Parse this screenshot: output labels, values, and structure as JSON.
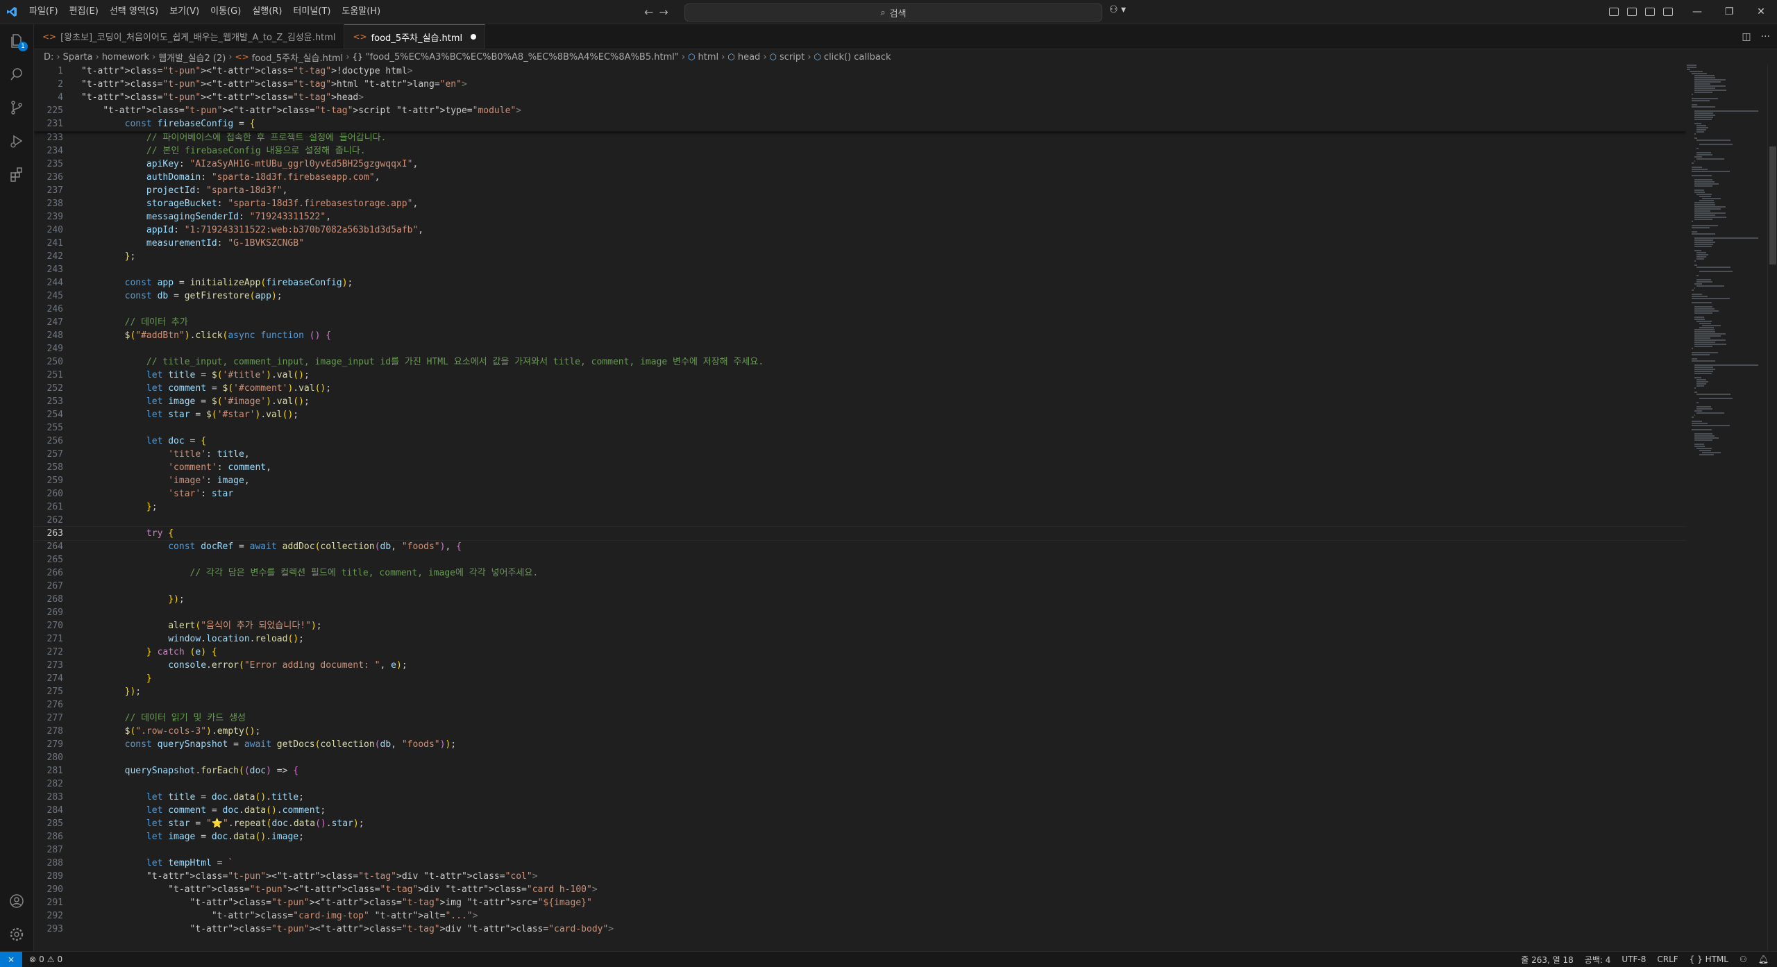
{
  "menus": [
    "파일(F)",
    "편집(E)",
    "선택 영역(S)",
    "보기(V)",
    "이동(G)",
    "실행(R)",
    "터미널(T)",
    "도움말(H)"
  ],
  "search_placeholder": "검색",
  "tabs": [
    {
      "label": "[왕초보]_코딩이_처음이어도_쉽게_배우는_웹개발_A_to_Z_김성윤.html",
      "active": false
    },
    {
      "label": "food_5주차_실습.html",
      "active": true,
      "dirty": true
    }
  ],
  "breadcrumbs": [
    "D:",
    "Sparta",
    "homework",
    "웹개발_실습2 (2)",
    "food_5주차_실습.html",
    "\"food_5%EC%A3%BC%EC%B0%A8_%EC%8B%A4%EC%8A%B5.html\"",
    "html",
    "head",
    "script",
    "click() callback"
  ],
  "sticky_lines": [
    {
      "n": "1",
      "code": "<!doctype html>"
    },
    {
      "n": "2",
      "code": "<html lang=\"en\">"
    },
    {
      "n": "4",
      "code": "<head>"
    },
    {
      "n": "225",
      "code": "    <script type=\"module\">"
    },
    {
      "n": "231",
      "code": "        const firebaseConfig = {"
    }
  ],
  "lines": [
    {
      "n": "233",
      "code": "            // 파이어베이스에 접속한 후 프로젝트 설정에 들어갑니다."
    },
    {
      "n": "234",
      "code": "            // 본인 firebaseConfig 내용으로 설정해 줍니다."
    },
    {
      "n": "235",
      "code": "            apiKey: \"AIzaSyAH1G-mtUBu_ggrl0yvEd5BH25gzgwqqxI\","
    },
    {
      "n": "236",
      "code": "            authDomain: \"sparta-18d3f.firebaseapp.com\","
    },
    {
      "n": "237",
      "code": "            projectId: \"sparta-18d3f\","
    },
    {
      "n": "238",
      "code": "            storageBucket: \"sparta-18d3f.firebasestorage.app\","
    },
    {
      "n": "239",
      "code": "            messagingSenderId: \"719243311522\","
    },
    {
      "n": "240",
      "code": "            appId: \"1:719243311522:web:b370b7082a563b1d3d5afb\","
    },
    {
      "n": "241",
      "code": "            measurementId: \"G-1BVKSZCNGB\""
    },
    {
      "n": "242",
      "code": "        };"
    },
    {
      "n": "243",
      "code": ""
    },
    {
      "n": "244",
      "code": "        const app = initializeApp(firebaseConfig);"
    },
    {
      "n": "245",
      "code": "        const db = getFirestore(app);"
    },
    {
      "n": "246",
      "code": ""
    },
    {
      "n": "247",
      "code": "        // 데이터 추가"
    },
    {
      "n": "248",
      "code": "        $(\"#addBtn\").click(async function () {"
    },
    {
      "n": "249",
      "code": ""
    },
    {
      "n": "250",
      "code": "            // title_input, comment_input, image_input id를 가진 HTML 요소에서 값을 가져와서 title, comment, image 변수에 저장해 주세요."
    },
    {
      "n": "251",
      "code": "            let title = $('#title').val();"
    },
    {
      "n": "252",
      "code": "            let comment = $('#comment').val();"
    },
    {
      "n": "253",
      "code": "            let image = $('#image').val();"
    },
    {
      "n": "254",
      "code": "            let star = $('#star').val();"
    },
    {
      "n": "255",
      "code": ""
    },
    {
      "n": "256",
      "code": "            let doc = {"
    },
    {
      "n": "257",
      "code": "                'title': title,"
    },
    {
      "n": "258",
      "code": "                'comment': comment,"
    },
    {
      "n": "259",
      "code": "                'image': image,"
    },
    {
      "n": "260",
      "code": "                'star': star"
    },
    {
      "n": "261",
      "code": "            };"
    },
    {
      "n": "262",
      "code": ""
    },
    {
      "n": "263",
      "code": "            try {",
      "current": true
    },
    {
      "n": "264",
      "code": "                const docRef = await addDoc(collection(db, \"foods\"), {"
    },
    {
      "n": "265",
      "code": ""
    },
    {
      "n": "266",
      "code": "                    // 각각 담은 변수를 컬렉션 필드에 title, comment, image에 각각 넣어주세요."
    },
    {
      "n": "267",
      "code": ""
    },
    {
      "n": "268",
      "code": "                });"
    },
    {
      "n": "269",
      "code": ""
    },
    {
      "n": "270",
      "code": "                alert(\"음식이 추가 되었습니다!\");"
    },
    {
      "n": "271",
      "code": "                window.location.reload();"
    },
    {
      "n": "272",
      "code": "            } catch (e) {"
    },
    {
      "n": "273",
      "code": "                console.error(\"Error adding document: \", e);"
    },
    {
      "n": "274",
      "code": "            }"
    },
    {
      "n": "275",
      "code": "        });"
    },
    {
      "n": "276",
      "code": ""
    },
    {
      "n": "277",
      "code": "        // 데이터 읽기 및 카드 생성"
    },
    {
      "n": "278",
      "code": "        $(\".row-cols-3\").empty();"
    },
    {
      "n": "279",
      "code": "        const querySnapshot = await getDocs(collection(db, \"foods\"));"
    },
    {
      "n": "280",
      "code": ""
    },
    {
      "n": "281",
      "code": "        querySnapshot.forEach((doc) => {"
    },
    {
      "n": "282",
      "code": ""
    },
    {
      "n": "283",
      "code": "            let title = doc.data().title;"
    },
    {
      "n": "284",
      "code": "            let comment = doc.data().comment;"
    },
    {
      "n": "285",
      "code": "            let star = \"⭐\".repeat(doc.data().star);"
    },
    {
      "n": "286",
      "code": "            let image = doc.data().image;"
    },
    {
      "n": "287",
      "code": ""
    },
    {
      "n": "288",
      "code": "            let tempHtml = `"
    },
    {
      "n": "289",
      "code": "            <div class=\"col\">"
    },
    {
      "n": "290",
      "code": "                <div class=\"card h-100\">"
    },
    {
      "n": "291",
      "code": "                    <img src=\"${image}\""
    },
    {
      "n": "292",
      "code": "                        class=\"card-img-top\" alt=\"...\">"
    },
    {
      "n": "293",
      "code": "                    <div class=\"card-body\">"
    }
  ],
  "status": {
    "errors": "0",
    "warnings": "0",
    "position": "줄 263, 열 18",
    "spaces": "공백: 4",
    "encoding": "UTF-8",
    "eol": "CRLF",
    "language": "HTML"
  },
  "colors": {
    "accent": "#0078d4",
    "background": "#1f1f1f"
  }
}
